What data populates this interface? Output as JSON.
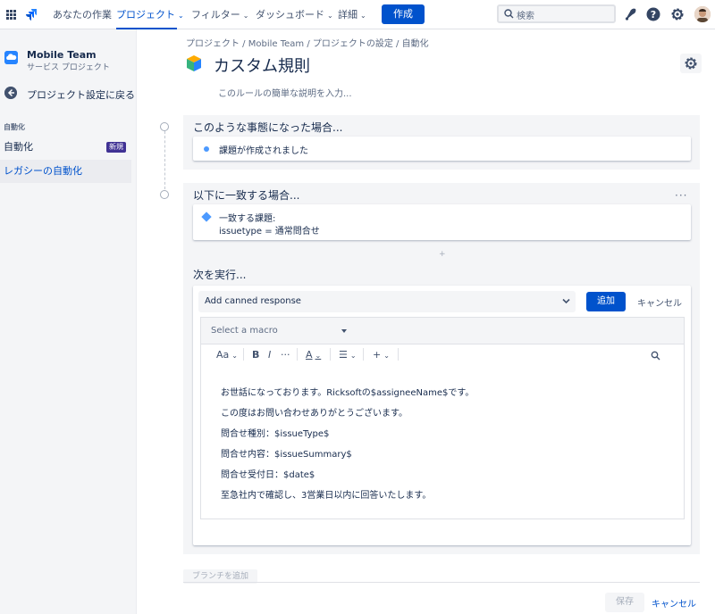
{
  "nav": {
    "items": [
      "あなたの作業",
      "プロジェクト",
      "フィルター",
      "ダッシュボード",
      "詳細"
    ],
    "active": "プロジェクト",
    "create_label": "作成",
    "search_placeholder": "検索"
  },
  "sidebar": {
    "project_name": "Mobile Team",
    "project_type": "サービス プロジェクト",
    "back_label": "プロジェクト設定に戻る",
    "section_label": "自動化",
    "items": [
      {
        "label": "自動化",
        "badge": "新規"
      },
      {
        "label": "レガシーの自動化"
      }
    ]
  },
  "breadcrumb": "プロジェクト  /  Mobile Team  /  プロジェクトの設定  /  自動化",
  "page": {
    "title": "カスタム規則",
    "description_placeholder": "このルールの簡単な説明を入力..."
  },
  "when": {
    "title": "このような事態になった場合...",
    "trigger": "課題が作成されました"
  },
  "if": {
    "title": "以下に一致する場合...",
    "condition_line1": "一致する課題:",
    "condition_line2": "issuetype = 通常問合せ"
  },
  "then": {
    "title": "次を実行...",
    "action_select": "Add canned response",
    "add_label": "追加",
    "cancel_label": "キャンセル",
    "macro_placeholder": "Select a macro",
    "body_lines": [
      "お世話になっております。Ricksoftの$assigneeName$です。",
      "この度はお問い合わせありがとうございます。",
      "問合せ種別：$issueType$",
      "問合せ内容：$issueSummary$",
      "問合せ受付日：$date$",
      "至急社内で確認し、3営業日以内に回答いたします。"
    ]
  },
  "footer": {
    "branch_label": "ブランチを追加",
    "save_label": "保存",
    "cancel_label": "キャンセル"
  },
  "toolbar": {
    "text_style": "Aa",
    "bold": "B",
    "italic": "I",
    "more": "···",
    "color": "A",
    "list": "☰",
    "insert": "+"
  }
}
